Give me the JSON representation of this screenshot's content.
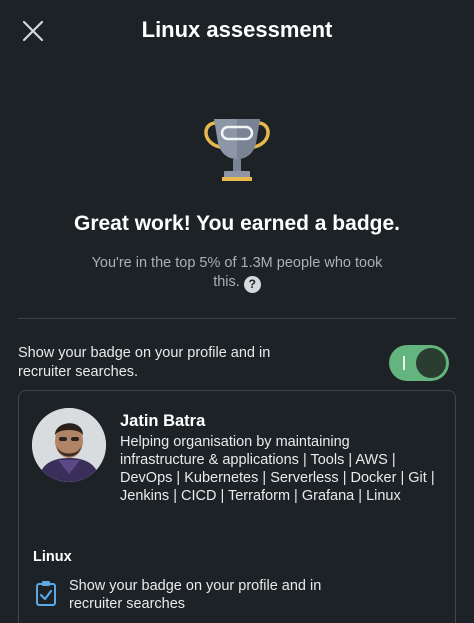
{
  "header": {
    "title": "Linux assessment",
    "close_icon": "close-icon"
  },
  "result": {
    "trophy_icon": "trophy-icon",
    "headline": "Great work! You earned a badge.",
    "subline": "You're in the top 5% of 1.3M people who took this.",
    "help_icon": "help-icon"
  },
  "badge_toggle": {
    "label": "Show your badge on your profile and in recruiter searches.",
    "enabled": true,
    "color": "#63b47e"
  },
  "profile_card": {
    "name": "Jatin Batra",
    "headline": "Helping organisation by maintaining infrastructure & applications | Tools | AWS | DevOps | Kubernetes | Serverless | Docker | Git | Jenkins | CICD | Terraform | Grafana | Linux",
    "skill": "Linux",
    "badge_note": "Show your badge on your profile and in recruiter searches",
    "clipboard_icon": "clipboard-check-icon"
  }
}
